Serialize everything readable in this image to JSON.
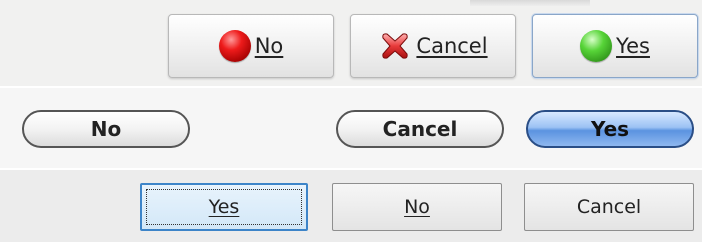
{
  "row_kde": {
    "no_label": "No",
    "cancel_label": "Cancel",
    "yes_label": "Yes"
  },
  "row_pill": {
    "no_label": "No",
    "cancel_label": "Cancel",
    "yes_label": "Yes"
  },
  "row_classic": {
    "yes_label": "Yes",
    "no_label": "No",
    "cancel_label": "Cancel"
  },
  "icons": {
    "no": "red-circle-icon",
    "cancel": "red-x-icon",
    "yes": "green-circle-icon"
  },
  "colors": {
    "accent_blue": "#5b93e0",
    "focus_blue": "#3d84c8",
    "no_red": "#ee1b1b",
    "yes_green": "#57d438"
  }
}
